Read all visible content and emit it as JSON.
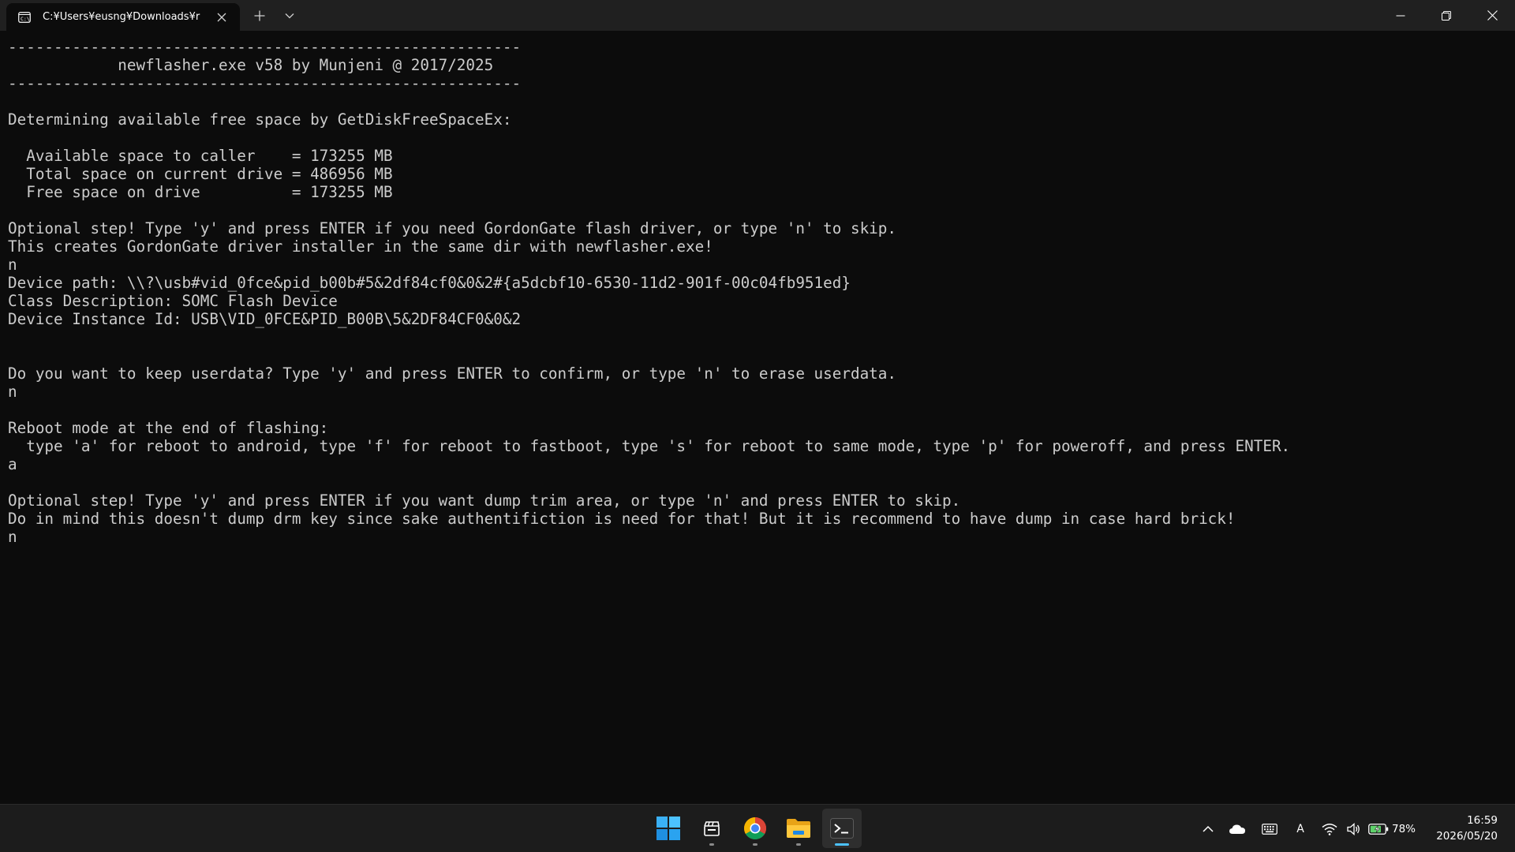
{
  "window": {
    "tab_title": "C:¥Users¥eusng¥Downloads¥r",
    "tab_icon": "terminal-icon",
    "controls": [
      "minimize-icon",
      "maximize-icon",
      "close-icon"
    ]
  },
  "terminal": {
    "lines": [
      "--------------------------------------------------------",
      "            newflasher.exe v58 by Munjeni @ 2017/2025",
      "--------------------------------------------------------",
      "",
      "Determining available free space by GetDiskFreeSpaceEx:",
      "",
      "  Available space to caller    = 173255 MB",
      "  Total space on current drive = 486956 MB",
      "  Free space on drive          = 173255 MB",
      "",
      "Optional step! Type 'y' and press ENTER if you need GordonGate flash driver, or type 'n' to skip.",
      "This creates GordonGate driver installer in the same dir with newflasher.exe!",
      "n",
      "Device path: \\\\?\\usb#vid_0fce&pid_b00b#5&2df84cf0&0&2#{a5dcbf10-6530-11d2-901f-00c04fb951ed}",
      "Class Description: SOMC Flash Device",
      "Device Instance Id: USB\\VID_0FCE&PID_B00B\\5&2DF84CF0&0&2",
      "",
      "",
      "Do you want to keep userdata? Type 'y' and press ENTER to confirm, or type 'n' to erase userdata.",
      "n",
      "",
      "Reboot mode at the end of flashing:",
      "  type 'a' for reboot to android, type 'f' for reboot to fastboot, type 's' for reboot to same mode, type 'p' for poweroff, and press ENTER.",
      "a",
      "",
      "Optional step! Type 'y' and press ENTER if you want dump trim area, or type 'n' and press ENTER to skip.",
      "Do in mind this doesn't dump drm key since sake authentifiction is need for that! But it is recommend to have dump in case hard brick!",
      "n"
    ]
  },
  "taskbar": {
    "apps": [
      {
        "name": "start-button",
        "icon": "windows-logo-icon"
      },
      {
        "name": "taskbar-app-clapper",
        "icon": "clapperboard-icon"
      },
      {
        "name": "taskbar-app-chrome",
        "icon": "chrome-icon"
      },
      {
        "name": "taskbar-app-file-explorer",
        "icon": "folder-icon"
      },
      {
        "name": "taskbar-app-terminal",
        "icon": "terminal-icon"
      }
    ],
    "tray": {
      "ime_label": "A",
      "battery_percent": "78%",
      "time": "16:59",
      "date": "2026/05/20"
    }
  },
  "colors": {
    "terminal_bg": "#0c0c0c",
    "terminal_fg": "#cccccc",
    "titlebar_bg": "#202020",
    "taskbar_bg": "#1c1c1c",
    "accent": "#4cc2ff"
  }
}
